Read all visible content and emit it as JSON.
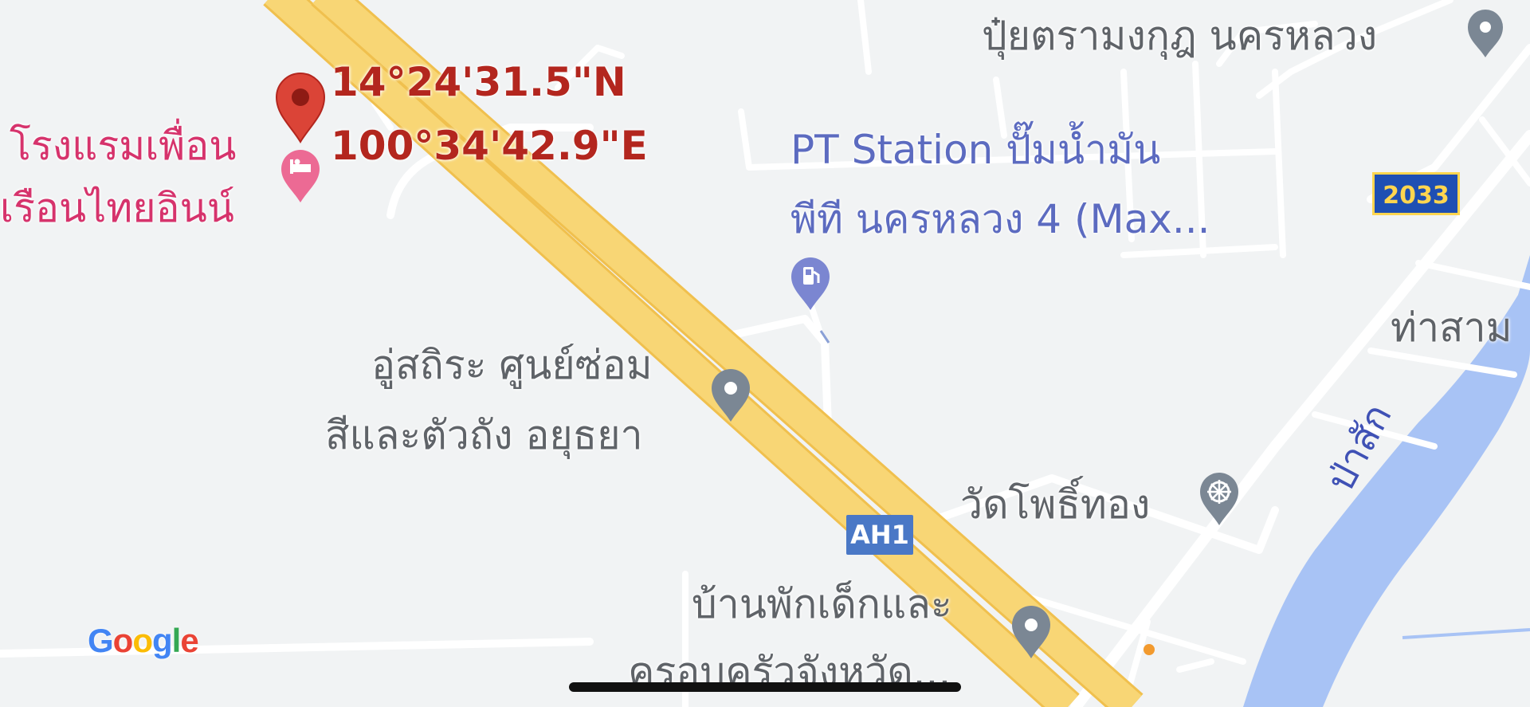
{
  "colors": {
    "background": "#f1f3f4",
    "highway_fill": "#f8d675",
    "highway_edge": "#f0c04e",
    "road": "#ffffff",
    "river": "#a8c3f5",
    "pin_red": "#db4437",
    "pin_gray": "#7b8794",
    "hotel_pink": "#ec6a94",
    "fuel_blue": "#7b86d1"
  },
  "map": {
    "dropped_pin": {
      "latitude": "14°24'31.5\"N",
      "longitude": "100°34'42.9\"E",
      "icon": "red-pin-icon"
    },
    "places": {
      "hotel": {
        "line1": "โรงแรมเพื่อน",
        "line2": "เรือนไทยอินน์",
        "icon": "hotel-bed-icon"
      },
      "fertilizer_shop": {
        "name": "ปุ๋ยตรามงกุฎ นครหลวง",
        "icon": "place-pin-icon"
      },
      "pt_station": {
        "line1": "PT Station ปั๊มน้ำมัน",
        "line2": "พีที นครหลวง 4 (Max...",
        "icon": "gas-station-icon"
      },
      "body_shop": {
        "line1": "อู่สถิระ ศูนย์ซ่อม",
        "line2": "สีและตัวถัง อยุธยา",
        "icon": "place-pin-icon"
      },
      "temple": {
        "name": "วัดโพธิ์ทอง",
        "icon": "dharma-wheel-icon"
      },
      "children_home": {
        "line1": "บ้านพักเด็กและ",
        "line2": "ครอบครัวจังหวัด...",
        "icon": "place-pin-icon"
      },
      "tha_sam": {
        "name": "ท่าสาม"
      }
    },
    "river_label": "ป่าสัก",
    "route_shields": {
      "ah1": "AH1",
      "r2033": "2033"
    },
    "attribution": {
      "letters": [
        "G",
        "o",
        "o",
        "g",
        "l",
        "e"
      ],
      "letter_colors": [
        "#4285f4",
        "#ea4335",
        "#fbbc05",
        "#4285f4",
        "#34a853",
        "#ea4335"
      ]
    }
  }
}
